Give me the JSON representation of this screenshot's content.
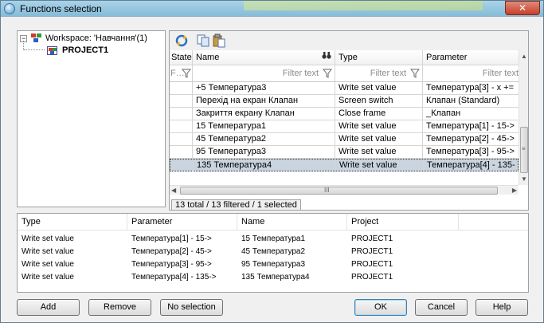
{
  "window": {
    "title": "Functions selection",
    "close_glyph": "✕"
  },
  "tree": {
    "workspace_label": "Workspace: 'Навчання'(1)",
    "project_label": "PROJECT1",
    "toggle_glyph": "−"
  },
  "grid": {
    "headers": {
      "state": "State",
      "name": "Name",
      "type": "Type",
      "parameter": "Parameter"
    },
    "filters": {
      "state": "F…",
      "name": "Filter text",
      "type": "Filter text",
      "parameter": "Filter text"
    },
    "rows": [
      {
        "name": "+5 Температура3",
        "type": "Write set value",
        "parameter": "Температура[3] - x +="
      },
      {
        "name": "Перехід на екран Клапан",
        "type": "Screen switch",
        "parameter": "Клапан (Standard)"
      },
      {
        "name": "Закриття екрану Клапан",
        "type": "Close frame",
        "parameter": "_Клапан"
      },
      {
        "name": "15 Температура1",
        "type": "Write set value",
        "parameter": "Температура[1] - 15->"
      },
      {
        "name": "45 Температура2",
        "type": "Write set value",
        "parameter": "Температура[2] - 45->"
      },
      {
        "name": "95 Температура3",
        "type": "Write set value",
        "parameter": "Температура[3] - 95->"
      },
      {
        "name": "135 Температура4",
        "type": "Write set value",
        "parameter": "Температура[4] - 135-"
      }
    ],
    "selected_row": 6,
    "scroll_glyphs": {
      "up": "▲",
      "down": "▼",
      "left": "◀",
      "right": "▶",
      "grip_v": "≡",
      "grip_h": "III"
    },
    "status": "13 total / 13 filtered / 1 selected"
  },
  "selection": {
    "headers": {
      "type": "Type",
      "parameter": "Parameter",
      "name": "Name",
      "project": "Project"
    },
    "rows": [
      {
        "type": "Write set value",
        "parameter": "Температура[1] - 15->",
        "name": "15 Температура1",
        "project": "PROJECT1"
      },
      {
        "type": "Write set value",
        "parameter": "Температура[2] - 45->",
        "name": "45 Температура2",
        "project": "PROJECT1"
      },
      {
        "type": "Write set value",
        "parameter": "Температура[3] - 95->",
        "name": "95 Температура3",
        "project": "PROJECT1"
      },
      {
        "type": "Write set value",
        "parameter": "Температура[4] - 135->",
        "name": "135 Температура4",
        "project": "PROJECT1"
      }
    ]
  },
  "buttons": {
    "add": "Add",
    "remove": "Remove",
    "no_selection": "No selection",
    "ok": "OK",
    "cancel": "Cancel",
    "help": "Help"
  },
  "colors": {
    "selected_row": "#c9d4df",
    "titlebar": "#86bcd8",
    "window_bg": "#f0f0f0"
  }
}
